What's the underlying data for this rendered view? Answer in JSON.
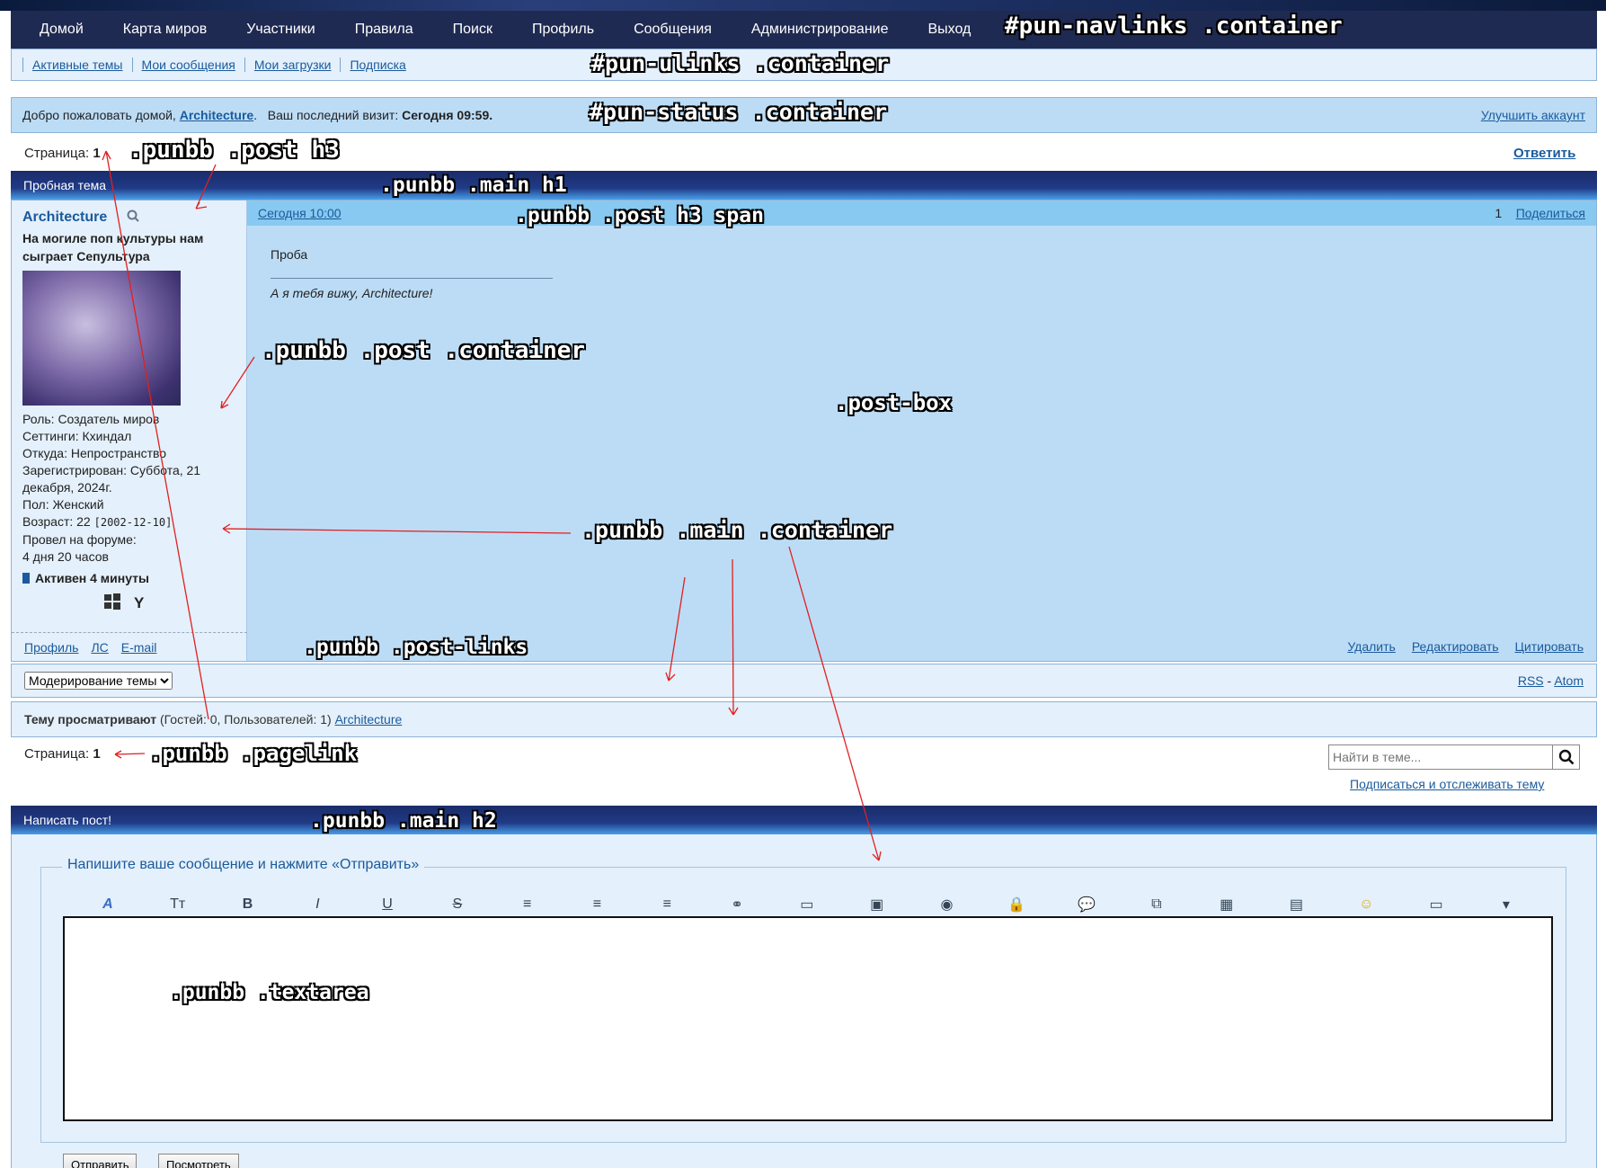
{
  "nav": [
    "Домой",
    "Карта миров",
    "Участники",
    "Правила",
    "Поиск",
    "Профиль",
    "Сообщения",
    "Администрирование",
    "Выход"
  ],
  "ulinks": [
    "Активные темы",
    "Мои сообщения",
    "Мои загрузки",
    "Подписка"
  ],
  "status": {
    "welcome": "Добро пожаловать домой,",
    "user": "Architecture",
    "last_visit_label": "Ваш последний визит:",
    "last_visit": "Сегодня 09:59.",
    "upgrade": "Улучшить аккаунт"
  },
  "page": {
    "label": "Страница:",
    "num": "1",
    "reply": "Ответить"
  },
  "topic": {
    "title": "Пробная тема"
  },
  "post": {
    "author": "Architecture",
    "author_title": "На могиле поп культуры нам сыграет Сепультура",
    "role": "Роль: Создатель миров",
    "settings": "Сеттинги: Кхиндал",
    "from": "Откуда: Непространство",
    "registered": "Зарегистрирован: Суббота, 21 декабря, 2024г.",
    "gender": "Пол: Женский",
    "age": "Возраст: 22",
    "age_date": "[2002-12-10]",
    "time_label": "Провел на форуме:",
    "time_value": "4 дня 20 часов",
    "active": "Активен 4 минуты",
    "date": "Сегодня 10:00",
    "num": "1",
    "share": "Поделиться",
    "body": "Проба",
    "signature": "А я тебя вижу, Architecture!",
    "authlinks": [
      "Профиль",
      "ЛС",
      "E-mail"
    ],
    "postlinks": [
      "Удалить",
      "Редактировать",
      "Цитировать"
    ]
  },
  "mod": {
    "select": "Модерирование темы",
    "rss": "RSS",
    "sep": "-",
    "atom": "Atom"
  },
  "viewers": {
    "label": "Тему просматривают",
    "counts": "(Гостей: 0, Пользователей: 1)",
    "user": "Architecture"
  },
  "search": {
    "placeholder": "Найти в теме...",
    "subscribe": "Подписаться и отслеживать тему"
  },
  "write": {
    "title": "Написать пост!",
    "legend": "Напишите ваше сообщение и нажмите «Отправить»",
    "toolbar_icons": [
      "font-icon",
      "size-icon",
      "bold-icon",
      "italic-icon",
      "underline-icon",
      "strike-icon",
      "align-left-icon",
      "align-center-icon",
      "align-right-icon",
      "link-icon",
      "image-icon",
      "spoiler-icon",
      "video-icon",
      "hide-icon",
      "quote-icon",
      "code-icon",
      "color-icon",
      "table-icon",
      "smile-icon",
      "upload-icon",
      "more-icon"
    ],
    "toolbar_glyphs": [
      "A",
      "Tт",
      "B",
      "I",
      "U",
      "S",
      "≡",
      "≡",
      "≡",
      "⚭",
      "▭",
      "▣",
      "◉",
      "🔒",
      "💬",
      "⧉",
      "▦",
      "▤",
      "☺",
      "▭",
      "▾"
    ],
    "submit": "Отправить",
    "preview": "Посмотреть"
  },
  "labels": {
    "navlinks": "#pun-navlinks .container",
    "ulinks": "#pun-ulinks .container",
    "status": "#pun-status .container",
    "post_h3": ".punbb .post h3",
    "main_h1": ".punbb .main h1",
    "post_h3_span": ".punbb .post h3 span",
    "post_container": ".punbb .post .container",
    "post_box": ".post-box",
    "main_container": ".punbb .main .container",
    "post_links": ".punbb .post-links",
    "pagelink": ".punbb .pagelink",
    "main_h2": ".punbb .main  h2",
    "textarea": ".punbb .textarea"
  }
}
